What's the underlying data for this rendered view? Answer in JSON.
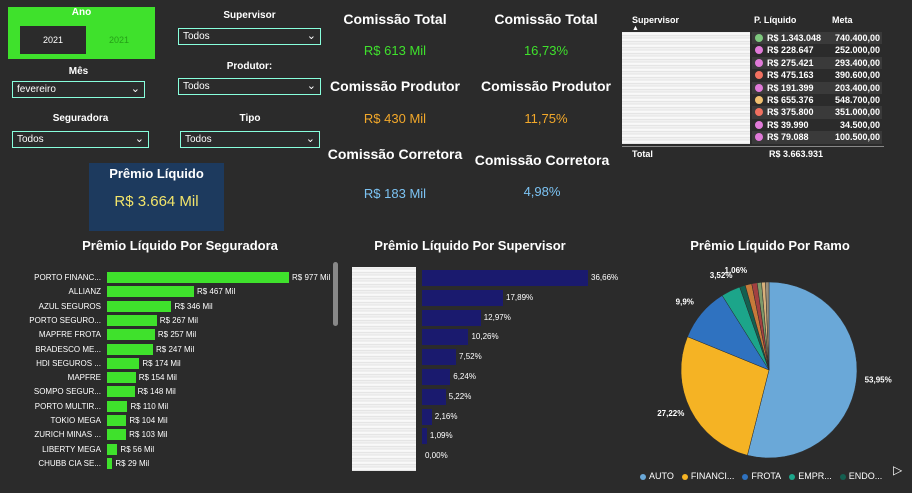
{
  "filters": {
    "ano_label": "Ano",
    "years": [
      "2021",
      "2021"
    ],
    "mes_label": "Mês",
    "mes_value": "fevereiro",
    "seguradora_label": "Seguradora",
    "seguradora_value": "Todos",
    "supervisor_label": "Supervisor",
    "supervisor_value": "Todos",
    "produtor_label": "Produtor:",
    "produtor_value": "Todos",
    "tipo_label": "Tipo",
    "tipo_value": "Todos"
  },
  "premio_card": {
    "title": "Prêmio Líquido",
    "value": "R$ 3.664 Mil"
  },
  "kpis": {
    "comissao_total_title": "Comissão Total",
    "comissao_total_value": "R$ 613 Mil",
    "comissao_total_pct_title": "Comissão Total",
    "comissao_total_pct": "16,73%",
    "comissao_produtor_title": "Comissão Produtor",
    "comissao_produtor_value": "R$ 430 Mil",
    "comissao_produtor_pct_title": "Comissão Produtor",
    "comissao_produtor_pct": "11,75%",
    "comissao_corretora_title": "Comissão Corretora",
    "comissao_corretora_value": "R$ 183 Mil",
    "comissao_corretora_pct_title": "Comissão Corretora",
    "comissao_corretora_pct": "4,98%"
  },
  "supervisor_table": {
    "headers": [
      "Supervisor",
      "P. Líquido",
      "Meta"
    ],
    "rows": [
      {
        "color": "#7ec87e",
        "premio": "R$ 1.343.048",
        "meta": "740.400,00"
      },
      {
        "color": "#e07ad8",
        "premio": "R$ 228.647",
        "meta": "252.000,00"
      },
      {
        "color": "#e07ad8",
        "premio": "R$ 275.421",
        "meta": "293.400,00"
      },
      {
        "color": "#f07060",
        "premio": "R$ 475.163",
        "meta": "390.600,00"
      },
      {
        "color": "#e07ad8",
        "premio": "R$ 191.399",
        "meta": "203.400,00"
      },
      {
        "color": "#f0c070",
        "premio": "R$ 655.376",
        "meta": "548.700,00"
      },
      {
        "color": "#f07060",
        "premio": "R$ 375.800",
        "meta": "351.000,00"
      },
      {
        "color": "#e07ad8",
        "premio": "R$ 39.990",
        "meta": "34.500,00"
      },
      {
        "color": "#e07ad8",
        "premio": "R$ 79.088",
        "meta": "100.500,00"
      }
    ],
    "total_label": "Total",
    "total_value": "R$ 3.663.931"
  },
  "chart_data": [
    {
      "type": "bar",
      "title": "Prêmio Líquido Por Seguradora",
      "orientation": "horizontal",
      "color": "#3fe12c",
      "categories": [
        "PORTO FINANC...",
        "ALLIANZ",
        "AZUL SEGUROS",
        "PORTO SEGURO...",
        "MAPFRE FROTA",
        "BRADESCO ME...",
        "HDI SEGUROS ...",
        "MAPFRE",
        "SOMPO SEGUR...",
        "PORTO MULTIR...",
        "TOKIO MEGA",
        "ZURICH MINAS ...",
        "LIBERTY MEGA",
        "CHUBB CIA SE..."
      ],
      "values": [
        977,
        467,
        346,
        267,
        257,
        247,
        174,
        154,
        148,
        110,
        104,
        103,
        56,
        29
      ],
      "labels": [
        "R$ 977 Mil",
        "R$ 467 Mil",
        "R$ 346 Mil",
        "R$ 267 Mil",
        "R$ 257 Mil",
        "R$ 247 Mil",
        "R$ 174 Mil",
        "R$ 154 Mil",
        "R$ 148 Mil",
        "R$ 110 Mil",
        "R$ 104 Mil",
        "R$ 103 Mil",
        "R$ 56 Mil",
        "R$ 29 Mil"
      ]
    },
    {
      "type": "bar",
      "title": "Prêmio Líquido Por Supervisor",
      "orientation": "horizontal",
      "color": "#1a1a6e",
      "values": [
        36.66,
        17.89,
        12.97,
        10.26,
        7.52,
        6.24,
        5.22,
        2.16,
        1.09,
        0.0
      ],
      "labels": [
        "36,66%",
        "17,89%",
        "12,97%",
        "10,26%",
        "7,52%",
        "6,24%",
        "5,22%",
        "2,16%",
        "1,09%",
        "0,00%"
      ]
    },
    {
      "type": "pie",
      "title": "Prêmio Líquido Por Ramo",
      "values": [
        53.95,
        27.22,
        9.9,
        3.52,
        1.06,
        1.2,
        1.0,
        0.8,
        0.7,
        0.65
      ],
      "labels": [
        "53,95%",
        "27,22%",
        "9,9%",
        "3,52%",
        "1,06%",
        "",
        "",
        "",
        "",
        ""
      ],
      "colors": [
        "#6aa8d8",
        "#f5b324",
        "#2f72c0",
        "#1ca58a",
        "#145f50",
        "#c77a3a",
        "#a34040",
        "#7e9a6a",
        "#d8b07a",
        "#9a8f7a"
      ],
      "legend": [
        "AUTO",
        "FINANCI...",
        "FROTA",
        "EMPR...",
        "ENDO..."
      ]
    }
  ]
}
